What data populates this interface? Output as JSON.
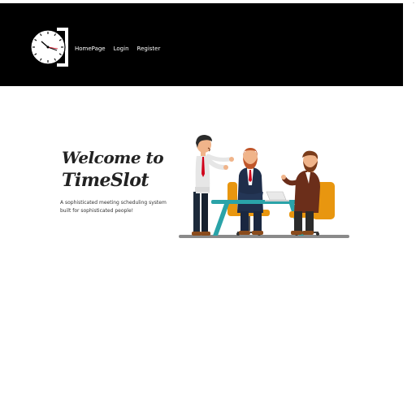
{
  "nav": {
    "links": [
      {
        "label": "HomePage"
      },
      {
        "label": "Login"
      },
      {
        "label": "Register"
      }
    ]
  },
  "hero": {
    "title_line1": "Welcome to",
    "title_line2": "TimeSlot",
    "subtitle": "A sophisticated meeting scheduling system built for sophisticated people!"
  },
  "icons": {
    "logo": "clock-icon",
    "illustration": "business-meeting-illustration"
  },
  "colors": {
    "navbar_bg": "#000000",
    "page_bg": "#ffffff",
    "nav_text": "#ffffff",
    "chair_orange": "#e8960f",
    "table_teal": "#2aa3a8"
  }
}
